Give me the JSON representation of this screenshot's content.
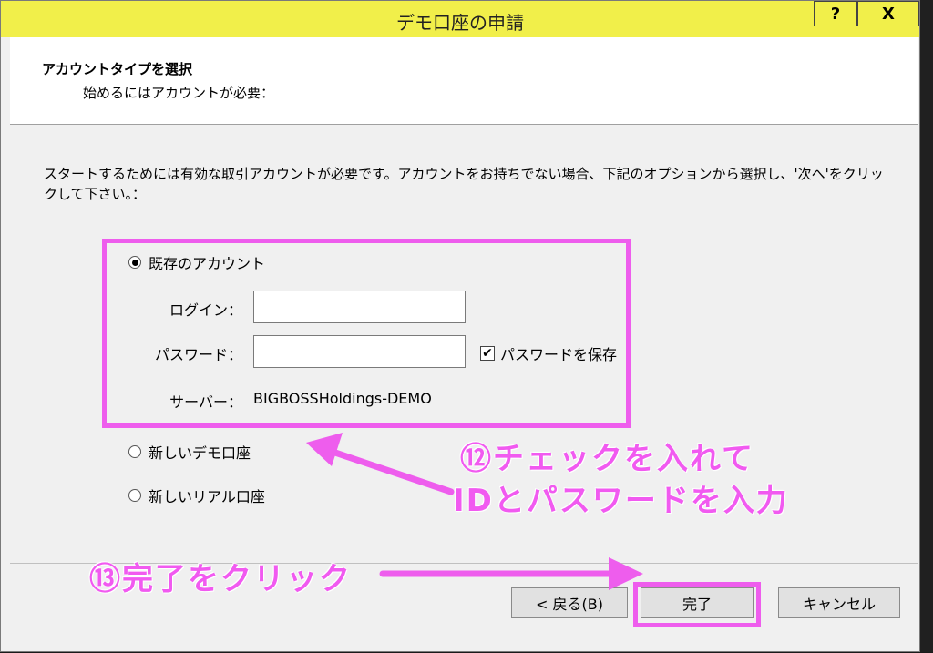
{
  "window": {
    "title": "デモ口座の申請",
    "help_label": "?",
    "close_label": "X"
  },
  "header": {
    "title": "アカウントタイプを選択",
    "subtitle": "始めるにはアカウントが必要："
  },
  "description": "スタートするためには有効な取引アカウントが必要です。アカウントをお持ちでない場合、下記のオプションから選択し、'次へ'をクリックして下さい。：",
  "options": {
    "existing_account": "既存のアカウント",
    "new_demo": "新しいデモ口座",
    "new_real": "新しいリアル口座"
  },
  "form": {
    "login_label": "ログイン：",
    "login_value": "",
    "password_label": "パスワード：",
    "password_value": "",
    "save_password_label": "パスワードを保存",
    "save_password_checked": true,
    "server_label": "サーバー：",
    "server_value": "BIGBOSSHoldings-DEMO"
  },
  "buttons": {
    "back": "< 戻る(B)",
    "finish": "完了",
    "cancel": "キャンセル"
  },
  "annotations": {
    "step12_line1": "⑫チェックを入れて",
    "step12_line2": "IDとパスワードを入力",
    "step13": "⑬完了をクリック"
  },
  "colors": {
    "titlebar": "#f1ef4a",
    "highlight": "#ee5ded"
  }
}
